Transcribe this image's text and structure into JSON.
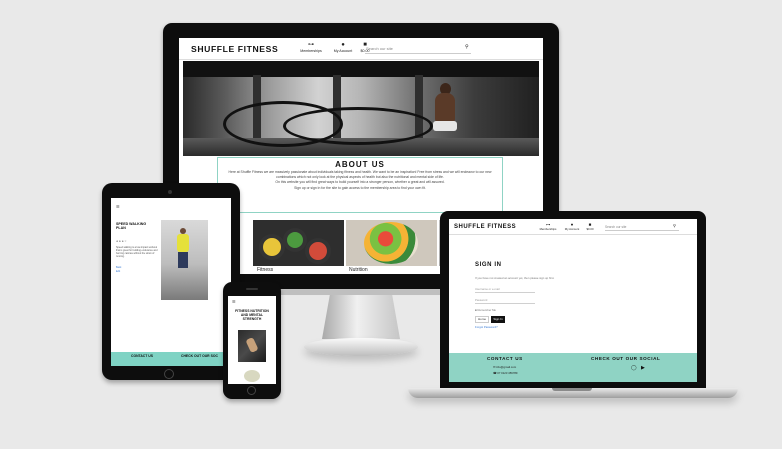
{
  "brand": "SHUFFLE FITNESS",
  "nav": [
    {
      "icon": "dumbbell-icon",
      "glyph": "⊶",
      "label": "Memberships"
    },
    {
      "icon": "user-icon",
      "glyph": "●",
      "label": "My Account"
    },
    {
      "icon": "bag-icon",
      "glyph": "■",
      "label": "$0.00"
    }
  ],
  "search": {
    "placeholder": "Search our site"
  },
  "about": {
    "title": "ABOUT US",
    "paragraphs": [
      "Here at Shuffle Fitness we are massively passionate about individuals taking fitness and health. We want to be an inspiration! Free from stress and we will endeavor to our new combinations which not only look at the physical aspects of health but also the nutritional and mental side of life.",
      "On this website you will find great ways to build yourself into a stronger person, whether a great and will assured.",
      "Sign up or sign in for the site to gain access to the membership area to find your own fit."
    ]
  },
  "cards": [
    {
      "label": ""
    },
    {
      "label": "Fitness"
    },
    {
      "label": "Nutrition"
    },
    {
      "label": ""
    }
  ],
  "tablet": {
    "title": "SPEED WALKING PLAN",
    "meta": "★ ★ ★ ☆",
    "body": "Speed walking is a low-impact workout that is great for building endurance and burning calories without the strain of running.",
    "links": [
      "Back",
      "Edit"
    ],
    "footer": {
      "left": "CONTACT US",
      "right": "CHECK OUT OUR SOC"
    }
  },
  "phone": {
    "title": "FITNESS NUTRITION AND MENTAL STRENGTH"
  },
  "signin": {
    "title": "SIGN IN",
    "intro": "If you have not created an account yet, then please sign up first.",
    "username_placeholder": "Username or e-mail",
    "password_placeholder": "Password",
    "remember_label": "Remember Me",
    "home_label": "Home",
    "signin_label": "Sign In",
    "forgot_label": "Forgot Password?"
  },
  "footer": {
    "contact_title": "CONTACT US",
    "email": "✉ info@gmail.com",
    "phone": "☎ 07 0123 456789",
    "social_title": "CHECK OUT OUR SOCIAL",
    "social_icons": [
      "instagram-icon",
      "youtube-icon"
    ]
  },
  "colors": {
    "accent": "#8fd3c4",
    "frame": "#0d0d0d",
    "link": "#3a7bd5"
  }
}
